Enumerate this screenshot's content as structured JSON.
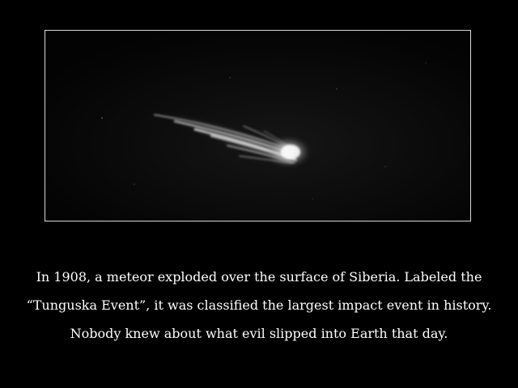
{
  "poster": {
    "image_subject": "meteor-streak",
    "colors": {
      "background": "#000000",
      "frame_border": "#d8d8d8",
      "text": "#ffffff"
    },
    "caption": {
      "line1": "In 1908, a meteor exploded over the surface of Siberia. Labeled the",
      "line2": "“Tunguska Event”, it was classified the largest impact event in history.",
      "line3": "Nobody knew about what evil slipped into Earth that day."
    }
  }
}
